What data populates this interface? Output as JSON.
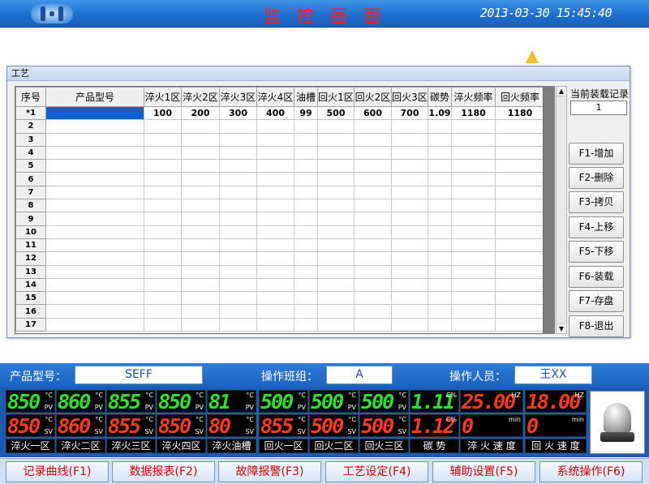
{
  "header": {
    "title": "监 控 画 面",
    "datetime": "2013-03-30 15:45:40"
  },
  "dialog": {
    "title": "工艺",
    "columns": [
      "序号",
      "产品型号",
      "淬火1区",
      "淬火2区",
      "淬火3区",
      "淬火4区",
      "油槽",
      "回火1区",
      "回火2区",
      "回火3区",
      "碳势",
      "淬火频率",
      "回火频率"
    ],
    "rows": [
      [
        "*1",
        "",
        "100",
        "200",
        "300",
        "400",
        "99",
        "500",
        "600",
        "700",
        "1.09",
        "1180",
        "1180"
      ],
      [
        "2"
      ],
      [
        "3"
      ],
      [
        "4"
      ],
      [
        "5"
      ],
      [
        "6"
      ],
      [
        "7"
      ],
      [
        "8"
      ],
      [
        "9"
      ],
      [
        "10"
      ],
      [
        "11"
      ],
      [
        "12"
      ],
      [
        "13"
      ],
      [
        "14"
      ],
      [
        "15"
      ],
      [
        "16"
      ],
      [
        "17"
      ]
    ],
    "current_record_label": "当前装载记录",
    "current_record_value": "1",
    "buttons": [
      "F1-增加",
      "F2-删除",
      "F3-拷贝",
      "F4-上移",
      "F5-下移",
      "F6-装载",
      "F7-存盘",
      "F8-退出"
    ]
  },
  "info": {
    "product_label": "产品型号：",
    "product_value": "SEFF",
    "team_label": "操作班组：",
    "team_value": "A",
    "operator_label": "操作人员：",
    "operator_value": "王XX"
  },
  "panel": {
    "pv": [
      {
        "value": "850",
        "unit": "°C",
        "sub": "PV"
      },
      {
        "value": "860",
        "unit": "°C",
        "sub": "PV"
      },
      {
        "value": "855",
        "unit": "°C",
        "sub": "PV"
      },
      {
        "value": "850",
        "unit": "°C",
        "sub": "PV"
      },
      {
        "value": "81",
        "unit": "°C",
        "sub": "PV"
      },
      {
        "value": "500",
        "unit": "°C",
        "sub": "PV"
      },
      {
        "value": "500",
        "unit": "°C",
        "sub": "PV"
      },
      {
        "value": "500",
        "unit": "°C",
        "sub": "PV"
      },
      {
        "value": "1.11",
        "unit": "C%",
        "sub": ""
      },
      {
        "value": "25.00",
        "unit": "HZ",
        "sub": ""
      },
      {
        "value": "18.00",
        "unit": "HZ",
        "sub": ""
      }
    ],
    "sv": [
      {
        "value": "850",
        "unit": "°C",
        "sub": "SV"
      },
      {
        "value": "860",
        "unit": "°C",
        "sub": "SV"
      },
      {
        "value": "855",
        "unit": "°C",
        "sub": "SV"
      },
      {
        "value": "850",
        "unit": "°C",
        "sub": "SV"
      },
      {
        "value": "80",
        "unit": "°C",
        "sub": "SV"
      },
      {
        "value": "855",
        "unit": "°C",
        "sub": "SV"
      },
      {
        "value": "500",
        "unit": "°C",
        "sub": "SV"
      },
      {
        "value": "500",
        "unit": "°C",
        "sub": "SV"
      },
      {
        "value": "1.12",
        "unit": "C%",
        "sub": ""
      },
      {
        "value": "0",
        "unit": "min",
        "sub": ""
      },
      {
        "value": "0",
        "unit": "min",
        "sub": ""
      }
    ],
    "labels": [
      "淬火一区",
      "淬火二区",
      "淬火三区",
      "淬火四区",
      "淬火油槽",
      "回火一区",
      "回火二区",
      "回火三区",
      "碳 势",
      "淬 火 速 度",
      "回 火 速 度"
    ]
  },
  "menu": [
    "记录曲线(F1)",
    "数据报表(F2)",
    "故障报警(F3)",
    "工艺设定(F4)",
    "辅助设置(F5)",
    "系统操作(F6)"
  ]
}
